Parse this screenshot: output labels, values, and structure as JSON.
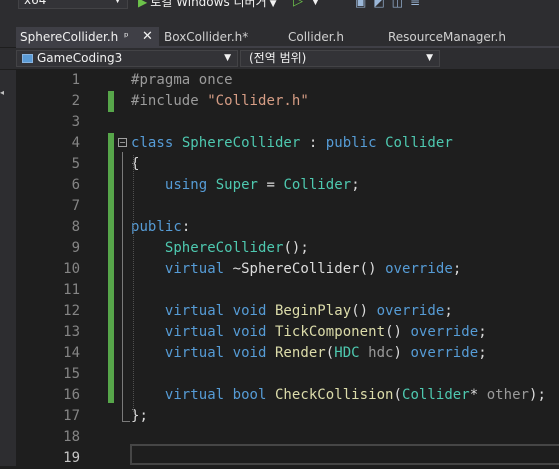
{
  "toolbar": {
    "platform": "x64",
    "run_label": "로컬 Windows 디버거",
    "right_icons": [
      "save-all-icon",
      "debug-icon",
      "bookmark-icon",
      "toolbar-more-icon"
    ]
  },
  "tabs": [
    {
      "label": "SphereCollider.h",
      "active": true,
      "pin": "ᵖ",
      "close": "✕"
    },
    {
      "label": "BoxCollider.h*",
      "active": false
    },
    {
      "label": "Collider.h",
      "active": false
    },
    {
      "label": "ResourceManager.h",
      "active": false
    }
  ],
  "navbar": {
    "project": "GameCoding3",
    "scope": "(전역 범위)"
  },
  "editor": {
    "current_line": 19,
    "lines": [
      {
        "num": "1",
        "tokens": [
          {
            "t": "#pragma once",
            "c": "pre"
          }
        ]
      },
      {
        "num": "2",
        "tokens": [
          {
            "t": "#include ",
            "c": "pre"
          },
          {
            "t": "\"Collider.h\"",
            "c": "str"
          }
        ]
      },
      {
        "num": "3",
        "tokens": []
      },
      {
        "num": "4",
        "tokens": [
          {
            "t": "class",
            "c": "kw"
          },
          {
            "t": " ",
            "c": "plain"
          },
          {
            "t": "SphereCollider",
            "c": "type"
          },
          {
            "t": " : ",
            "c": "plain"
          },
          {
            "t": "public",
            "c": "kw"
          },
          {
            "t": " ",
            "c": "plain"
          },
          {
            "t": "Collider",
            "c": "type"
          }
        ]
      },
      {
        "num": "5",
        "tokens": [
          {
            "t": "{",
            "c": "plain"
          }
        ]
      },
      {
        "num": "6",
        "tokens": [
          {
            "t": "    ",
            "c": "plain"
          },
          {
            "t": "using",
            "c": "kw"
          },
          {
            "t": " ",
            "c": "plain"
          },
          {
            "t": "Super",
            "c": "type"
          },
          {
            "t": " = ",
            "c": "plain"
          },
          {
            "t": "Collider",
            "c": "type"
          },
          {
            "t": ";",
            "c": "plain"
          }
        ]
      },
      {
        "num": "7",
        "tokens": []
      },
      {
        "num": "8",
        "tokens": [
          {
            "t": "public",
            "c": "kw"
          },
          {
            "t": ":",
            "c": "plain"
          }
        ]
      },
      {
        "num": "9",
        "tokens": [
          {
            "t": "    ",
            "c": "plain"
          },
          {
            "t": "SphereCollider",
            "c": "type"
          },
          {
            "t": "();",
            "c": "plain"
          }
        ]
      },
      {
        "num": "10",
        "tokens": [
          {
            "t": "    ",
            "c": "plain"
          },
          {
            "t": "virtual",
            "c": "kw"
          },
          {
            "t": " ~SphereCollider() ",
            "c": "plain"
          },
          {
            "t": "override",
            "c": "kw"
          },
          {
            "t": ";",
            "c": "plain"
          }
        ]
      },
      {
        "num": "11",
        "tokens": []
      },
      {
        "num": "12",
        "tokens": [
          {
            "t": "    ",
            "c": "plain"
          },
          {
            "t": "virtual",
            "c": "kw"
          },
          {
            "t": " ",
            "c": "plain"
          },
          {
            "t": "void",
            "c": "kw"
          },
          {
            "t": " ",
            "c": "plain"
          },
          {
            "t": "BeginPlay",
            "c": "fn"
          },
          {
            "t": "() ",
            "c": "plain"
          },
          {
            "t": "override",
            "c": "kw"
          },
          {
            "t": ";",
            "c": "plain"
          }
        ]
      },
      {
        "num": "13",
        "tokens": [
          {
            "t": "    ",
            "c": "plain"
          },
          {
            "t": "virtual",
            "c": "kw"
          },
          {
            "t": " ",
            "c": "plain"
          },
          {
            "t": "void",
            "c": "kw"
          },
          {
            "t": " ",
            "c": "plain"
          },
          {
            "t": "TickComponent",
            "c": "fn"
          },
          {
            "t": "() ",
            "c": "plain"
          },
          {
            "t": "override",
            "c": "kw"
          },
          {
            "t": ";",
            "c": "plain"
          }
        ]
      },
      {
        "num": "14",
        "tokens": [
          {
            "t": "    ",
            "c": "plain"
          },
          {
            "t": "virtual",
            "c": "kw"
          },
          {
            "t": " ",
            "c": "plain"
          },
          {
            "t": "void",
            "c": "kw"
          },
          {
            "t": " ",
            "c": "plain"
          },
          {
            "t": "Render",
            "c": "fn"
          },
          {
            "t": "(",
            "c": "plain"
          },
          {
            "t": "HDC",
            "c": "type"
          },
          {
            "t": " ",
            "c": "plain"
          },
          {
            "t": "hdc",
            "c": "param"
          },
          {
            "t": ") ",
            "c": "plain"
          },
          {
            "t": "override",
            "c": "kw"
          },
          {
            "t": ";",
            "c": "plain"
          }
        ]
      },
      {
        "num": "15",
        "tokens": []
      },
      {
        "num": "16",
        "tokens": [
          {
            "t": "    ",
            "c": "plain"
          },
          {
            "t": "virtual",
            "c": "kw"
          },
          {
            "t": " ",
            "c": "plain"
          },
          {
            "t": "bool",
            "c": "kw"
          },
          {
            "t": " ",
            "c": "plain"
          },
          {
            "t": "CheckCollision",
            "c": "fn"
          },
          {
            "t": "(",
            "c": "plain"
          },
          {
            "t": "Collider",
            "c": "type"
          },
          {
            "t": "* ",
            "c": "plain"
          },
          {
            "t": "other",
            "c": "param"
          },
          {
            "t": ");",
            "c": "plain"
          }
        ]
      },
      {
        "num": "17",
        "tokens": [
          {
            "t": "};",
            "c": "plain"
          }
        ]
      },
      {
        "num": "18",
        "tokens": []
      },
      {
        "num": "19",
        "tokens": []
      }
    ]
  }
}
